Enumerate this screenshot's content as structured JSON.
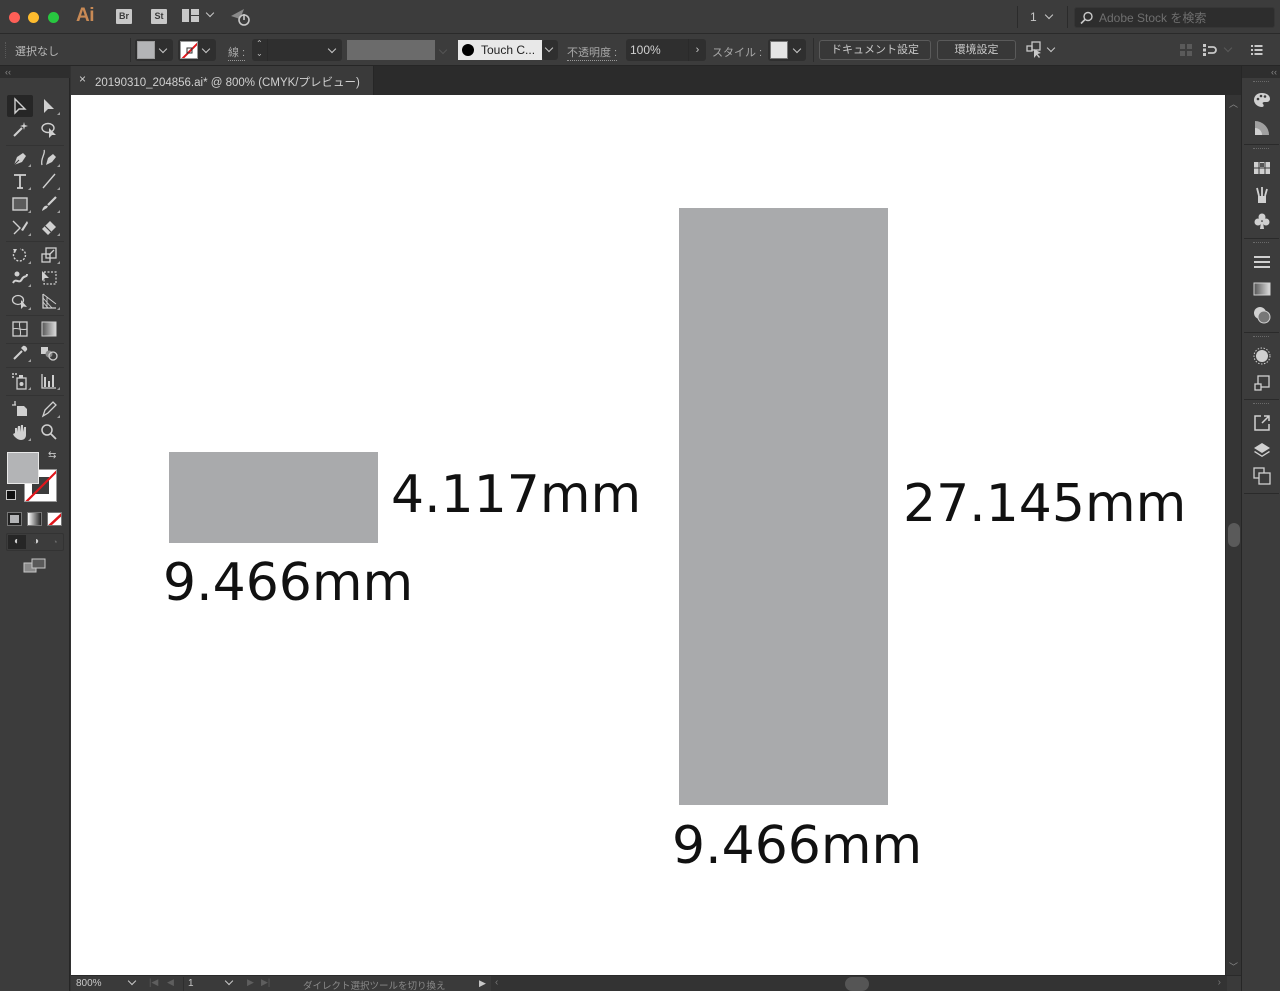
{
  "app": {
    "logo": "Ai",
    "bridge_badge": "Br",
    "stock_badge": "St",
    "page_selector": "1",
    "stock_search_placeholder": "Adobe Stock を検索"
  },
  "control_bar": {
    "selection_label": "選択なし",
    "stroke_label": "線 :",
    "stroke_weight_value": "",
    "brush_label": "Touch C...",
    "opacity_label": "不透明度 :",
    "opacity_value": "100%",
    "style_label": "スタイル :",
    "document_setup_button": "ドキュメント設定",
    "preferences_button": "環境設定"
  },
  "document": {
    "tab_title": "20190310_204856.ai* @ 800% (CMYK/プレビュー)",
    "close_glyph": "×"
  },
  "canvas": {
    "shape_fill": "#a9aaac",
    "objects": [
      {
        "name": "small-rectangle",
        "width_mm": 9.466,
        "height_mm": 4.117,
        "width_label": "9.466mm",
        "height_label": "4.117mm"
      },
      {
        "name": "tall-rectangle",
        "width_mm": 9.466,
        "height_mm": 27.145,
        "width_label": "9.466mm",
        "height_label": "27.145mm"
      }
    ]
  },
  "colors": {
    "fill_swatch": "#b3b4b6",
    "stroke_none_slash": "#e0161b",
    "ui_dark": "#323232",
    "ui_panel": "#3c3c3c"
  },
  "tools": [
    "selection-tool",
    "direct-selection-tool",
    "magic-wand-tool",
    "lasso-tool",
    "pen-tool",
    "curvature-tool",
    "type-tool",
    "line-segment-tool",
    "rectangle-tool",
    "paintbrush-tool",
    "shaper-tool",
    "eraser-tool",
    "rotate-tool",
    "scale-tool",
    "warp-tool",
    "free-transform-tool",
    "shape-builder-tool",
    "perspective-grid-tool",
    "mesh-tool",
    "gradient-tool",
    "eyedropper-tool",
    "blend-tool",
    "symbol-sprayer-tool",
    "column-graph-tool",
    "artboard-tool",
    "slice-tool",
    "hand-tool",
    "zoom-tool"
  ],
  "status_bar": {
    "zoom": "800%",
    "artboard": "1",
    "status_text": "ダイレクト選択ツールを切り換え"
  }
}
